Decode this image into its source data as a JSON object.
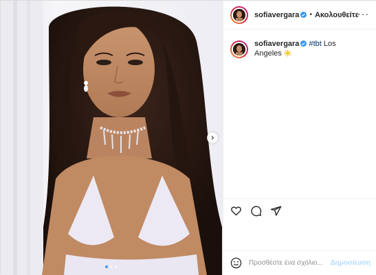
{
  "post": {
    "username": "sofiavergara",
    "verified": true,
    "follow_label": "Ακολουθείτε",
    "separator": "•",
    "more_icon": "more-dots-icon"
  },
  "caption": {
    "username": "sofiavergara",
    "hashtag": "#tbt",
    "text": " Los Angeles ",
    "emoji_icon": "sun-emoji-icon"
  },
  "media": {
    "slides_total": 3,
    "active_slide": 1,
    "next_icon": "chevron-right-icon"
  },
  "actions": {
    "icons": [
      "heart-icon",
      "comment-icon",
      "share-icon"
    ]
  },
  "comment_box": {
    "placeholder": "Προσθέστε ένα σχόλιο...",
    "post_label": "Δημοσίευση"
  },
  "colors": {
    "link": "#00376b",
    "verified": "#3897f0",
    "post_button": "#b3dbff"
  }
}
